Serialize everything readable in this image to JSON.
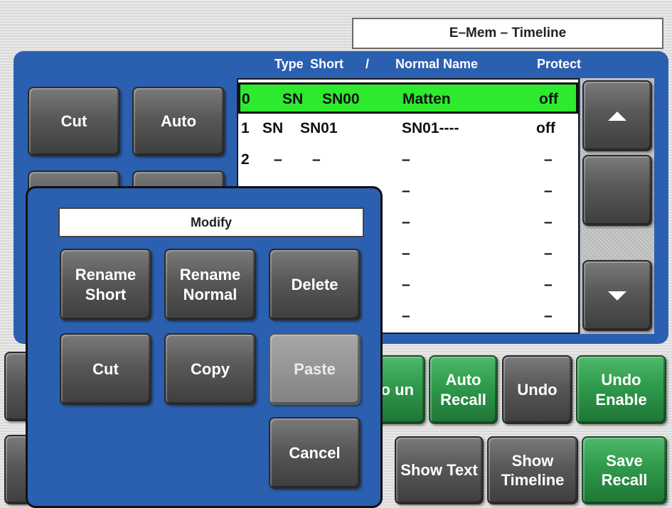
{
  "window": {
    "title": "E–Mem – Timeline"
  },
  "table": {
    "columns": {
      "type": "Type",
      "short": "Short",
      "sort_mark": "/",
      "normal": "Normal Name",
      "protect": "Protect"
    },
    "rows": [
      {
        "idx": "0",
        "type": "SN",
        "short": "SN00",
        "normal": "Matten",
        "protect": "off",
        "selected": true
      },
      {
        "idx": "1",
        "type": "SN",
        "short": "SN01",
        "normal": "SN01----",
        "protect": "off",
        "selected": false
      },
      {
        "idx": "2",
        "type": "–",
        "short": "–",
        "normal": "–",
        "protect": "–",
        "selected": false
      },
      {
        "normal": "–",
        "protect": "–"
      },
      {
        "normal": "–",
        "protect": "–"
      },
      {
        "normal": "–",
        "protect": "–"
      },
      {
        "normal": "–",
        "protect": "–"
      },
      {
        "normal": "–",
        "protect": "–"
      }
    ]
  },
  "left_buttons": {
    "cut": "Cut",
    "auto": "Auto"
  },
  "scroll": {
    "up_icon": "triangle-up",
    "down_icon": "triangle-down"
  },
  "modal": {
    "title": "Modify",
    "rename_short": "Rename Short",
    "rename_normal": "Rename Normal",
    "delete": "Delete",
    "cut": "Cut",
    "copy": "Copy",
    "paste": "Paste",
    "cancel": "Cancel"
  },
  "bottom_row1": {
    "auto_run_partial": "uto un",
    "auto_recall": "Auto Recall",
    "undo": "Undo",
    "undo_enable": "Undo Enable"
  },
  "bottom_row2": {
    "show_text": "Show Text",
    "show_timeline": "Show Timeline",
    "save_recall": "Save Recall"
  },
  "colors": {
    "panel": "#2b60b0",
    "selected_row": "#2eea2e",
    "green_button": "#2f9a4b"
  }
}
